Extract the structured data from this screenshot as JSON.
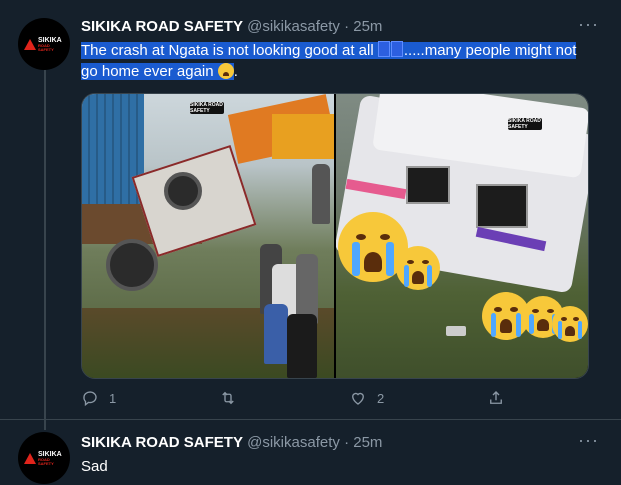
{
  "tweets": [
    {
      "author_name": "SIKIKA ROAD SAFETY",
      "handle": "@sikikasafety",
      "time": "25m",
      "text_part1": "The crash at Ngata is not looking good at all",
      "text_part2": ".....many people might not",
      "text_part3": "go home ever again",
      "text_end": ".",
      "reply_count": "1",
      "retweet_count": "",
      "like_count": "2",
      "watermark": "SIKIKA ROAD SAFETY"
    },
    {
      "author_name": "SIKIKA ROAD SAFETY",
      "handle": "@sikikasafety",
      "time": "25m",
      "text": "Sad"
    }
  ],
  "avatar_logo": {
    "line1": "SIKIKA",
    "line2": "ROAD SAFETY"
  },
  "more_icon": "···",
  "dot": "·",
  "icons": [
    "reply-icon",
    "retweet-icon",
    "like-icon",
    "share-icon",
    "more-icon"
  ],
  "colors": {
    "background": "#15202b",
    "highlight": "#1a5bd0",
    "secondary_text": "#8b98a5",
    "divider": "#38444d"
  }
}
